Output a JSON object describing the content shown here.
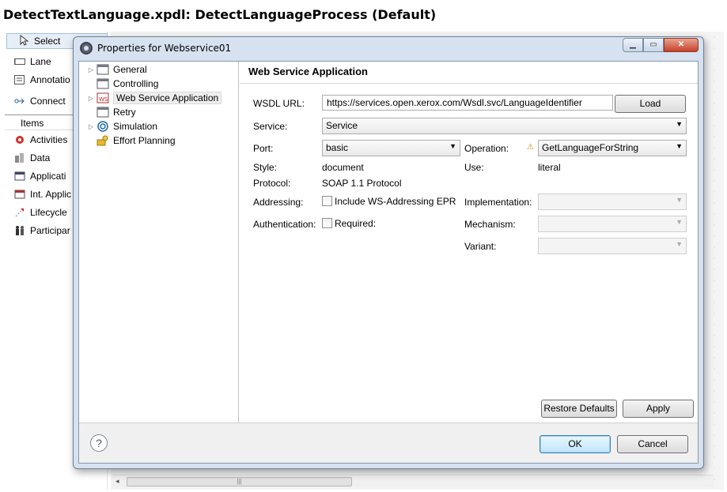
{
  "editor": {
    "title": "DetectTextLanguage.xpdl: DetectLanguageProcess (Default)"
  },
  "palette": {
    "tools": [
      {
        "label": "Select",
        "icon": "cursor-arrow-icon"
      },
      {
        "label": "Lane",
        "icon": "lane-icon"
      },
      {
        "label": "Annotatio",
        "icon": "annotation-icon"
      },
      {
        "label": "Connect",
        "icon": "connect-icon"
      }
    ],
    "section": "Items",
    "items": [
      {
        "label": "Activities",
        "icon": "activities-gear-icon"
      },
      {
        "label": "Data",
        "icon": "data-icon"
      },
      {
        "label": "Applicati",
        "icon": "application-icon"
      },
      {
        "label": "Int. Applic",
        "icon": "int-application-icon"
      },
      {
        "label": "Lifecycle",
        "icon": "lifecycle-icon"
      },
      {
        "label": "Participar",
        "icon": "participant-icon"
      }
    ]
  },
  "dialog": {
    "title": "Properties for Webservice01",
    "tree": [
      {
        "label": "General",
        "expandable": true
      },
      {
        "label": "Controlling",
        "expandable": false
      },
      {
        "label": "Web Service Application",
        "expandable": true,
        "selected": true
      },
      {
        "label": "Retry",
        "expandable": false
      },
      {
        "label": "Simulation",
        "expandable": true
      },
      {
        "label": "Effort Planning",
        "expandable": false
      }
    ],
    "page": {
      "title": "Web Service Application",
      "wsdl_label": "WSDL URL:",
      "wsdl_value": "https://services.open.xerox.com/Wsdl.svc/LanguageIdentifier",
      "load_button": "Load",
      "service_label": "Service:",
      "service_value": "Service",
      "port_label": "Port:",
      "port_value": "basic",
      "operation_label": "Operation:",
      "operation_value": "GetLanguageForString",
      "style_label": "Style:",
      "style_value": "document",
      "use_label": "Use:",
      "use_value": "literal",
      "protocol_label": "Protocol:",
      "protocol_value": "SOAP 1.1 Protocol",
      "addressing_label": "Addressing:",
      "addressing_checkbox": "Include WS-Addressing EPR",
      "implementation_label": "Implementation:",
      "authentication_label": "Authentication:",
      "authentication_checkbox": "Required:",
      "mechanism_label": "Mechanism:",
      "variant_label": "Variant:",
      "restore_defaults_button": "Restore Defaults",
      "apply_button": "Apply"
    },
    "ok_button": "OK",
    "cancel_button": "Cancel"
  }
}
